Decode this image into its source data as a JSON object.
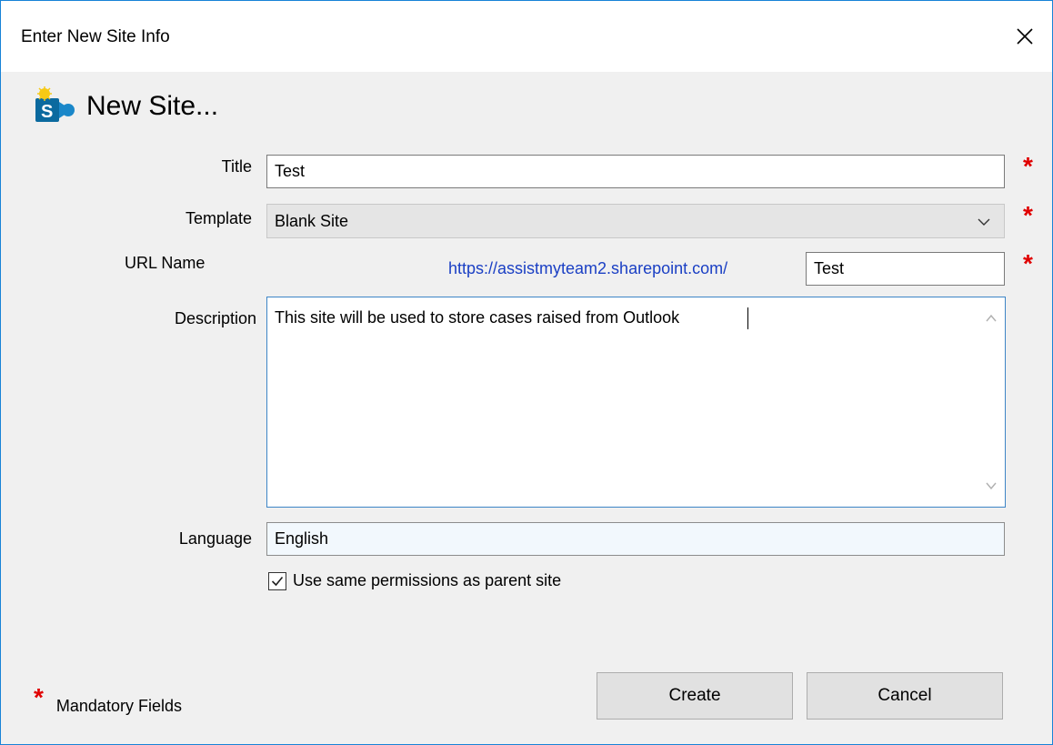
{
  "window": {
    "title": "Enter New Site Info",
    "close_glyph": "✕"
  },
  "header": {
    "heading": "New Site...",
    "icon": "sharepoint-new-site-icon"
  },
  "form": {
    "title_label": "Title",
    "title_value": "Test",
    "template_label": "Template",
    "template_value": "Blank Site",
    "url_label": "URL Name",
    "url_prefix": "https://assistmyteam2.sharepoint.com/",
    "url_value": "Test",
    "description_label": "Description",
    "description_value": "This site will be used to store cases raised from Outlook",
    "language_label": "Language",
    "language_value": "English",
    "permissions_label": "Use same permissions as parent site",
    "permissions_checked": true,
    "required_marker": "*"
  },
  "footer": {
    "mandatory_marker": "*",
    "mandatory_label": "Mandatory Fields",
    "create_label": "Create",
    "cancel_label": "Cancel"
  },
  "colors": {
    "required": "#e00000",
    "url_link": "#1a3fc4",
    "focus_border": "#3d85c6",
    "window_border": "#1883d7"
  }
}
